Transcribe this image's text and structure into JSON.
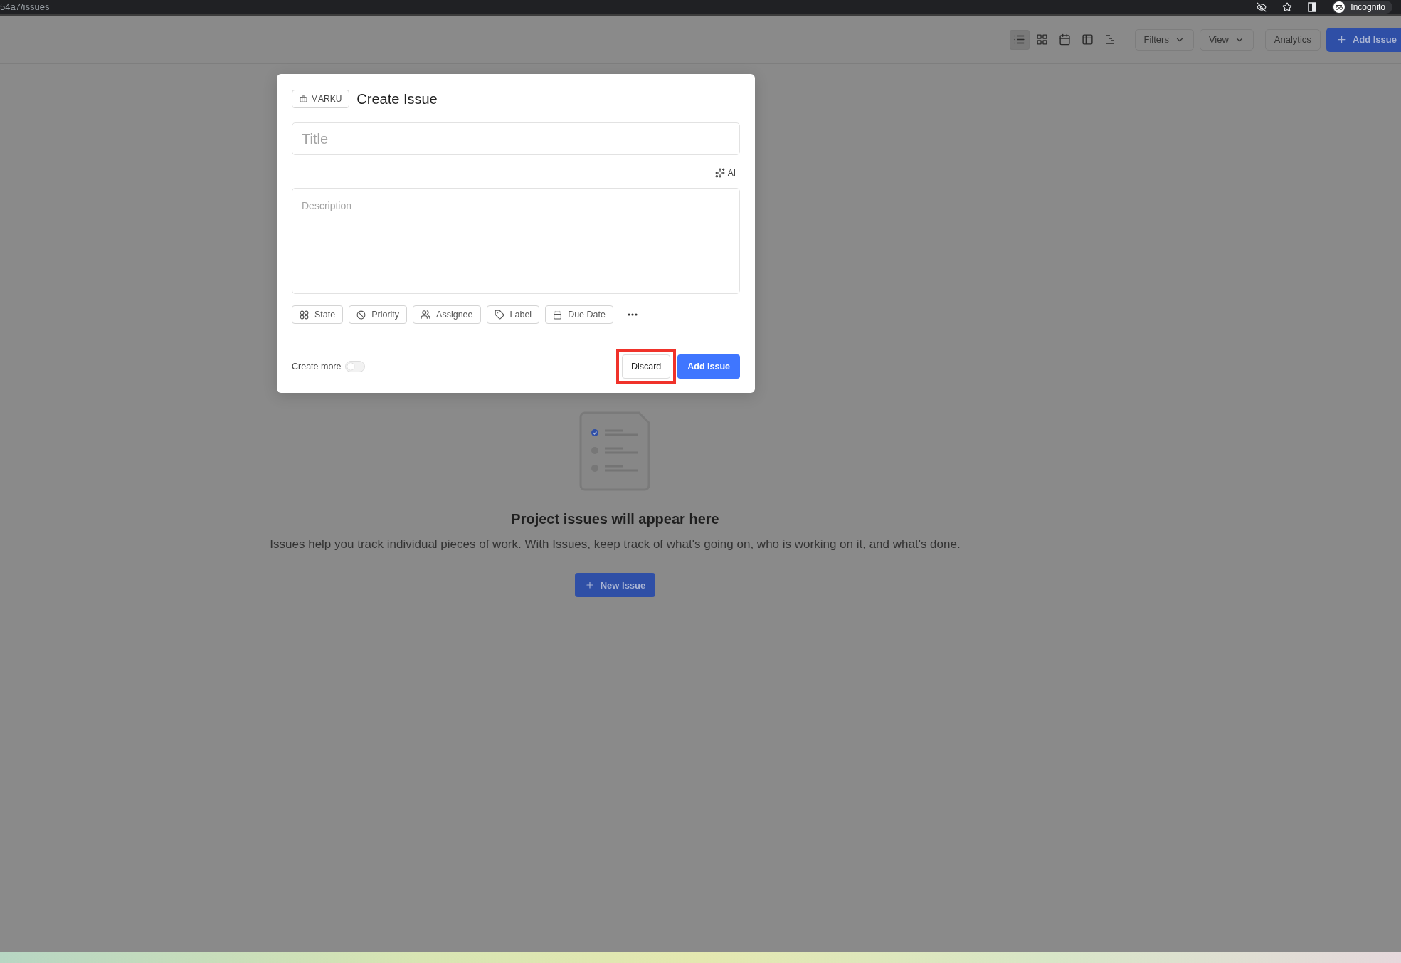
{
  "browser": {
    "url": "54a7/issues",
    "profile": "Incognito"
  },
  "toolbar": {
    "layouts": [
      {
        "kind": "list",
        "selected": true
      },
      {
        "kind": "grid",
        "selected": false
      },
      {
        "kind": "calendar",
        "selected": false
      },
      {
        "kind": "spreadsheet",
        "selected": false
      },
      {
        "kind": "gantt",
        "selected": false
      }
    ],
    "filters": "Filters",
    "view": "View",
    "analytics": "Analytics",
    "add_issue": "Add Issue"
  },
  "modal": {
    "project": "MARKU",
    "title": "Create Issue",
    "title_placeholder": "Title",
    "ai": "AI",
    "description_placeholder": "Description",
    "properties": [
      {
        "kind": "state",
        "label": "State"
      },
      {
        "kind": "priority",
        "label": "Priority"
      },
      {
        "kind": "assignee",
        "label": "Assignee"
      },
      {
        "kind": "label",
        "label": "Label"
      },
      {
        "kind": "due_date",
        "label": "Due Date"
      }
    ],
    "create_more": {
      "label": "Create more",
      "on": false
    },
    "discard": {
      "label": "Discard",
      "highlighted": true
    },
    "submit": "Add Issue"
  },
  "empty_state": {
    "heading": "Project issues will appear here",
    "text": "Issues help you track individual pieces of work. With Issues, keep track of what's going on, who is working on it, and what's done.",
    "button": "New Issue"
  }
}
